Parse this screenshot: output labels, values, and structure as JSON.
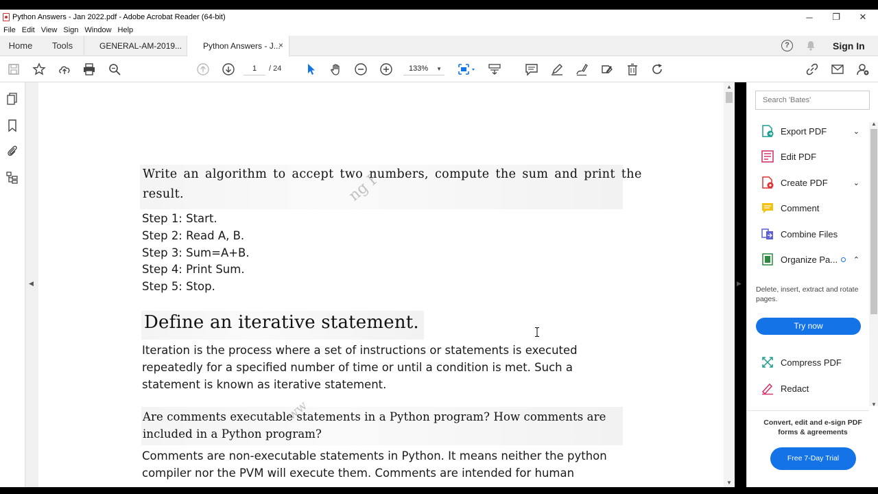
{
  "window": {
    "title": "Python Answers - Jan 2022.pdf - Adobe Acrobat Reader (64-bit)",
    "controls": {
      "minimize": "─",
      "maximize": "❐",
      "close": "✕"
    }
  },
  "menu": [
    "File",
    "Edit",
    "View",
    "Sign",
    "Window",
    "Help"
  ],
  "tabs": {
    "home": "Home",
    "tools": "Tools",
    "docs": [
      {
        "label": "GENERAL-AM-2019..."
      },
      {
        "label": "Python Answers - J...",
        "close": "×"
      }
    ],
    "help": "?",
    "signin": "Sign In"
  },
  "toolbar": {
    "page_current": "1",
    "page_total": "/ 24",
    "zoom": "133%",
    "zoom_caret": "▼"
  },
  "right_panel": {
    "search_placeholder": "Search 'Bates'",
    "items": [
      {
        "label": "Export PDF",
        "icon": "export-pdf-icon",
        "chevron": "⌄"
      },
      {
        "label": "Edit PDF",
        "icon": "edit-pdf-icon"
      },
      {
        "label": "Create PDF",
        "icon": "create-pdf-icon",
        "chevron": "⌄"
      },
      {
        "label": "Comment",
        "icon": "comment-icon"
      },
      {
        "label": "Combine Files",
        "icon": "combine-files-icon"
      },
      {
        "label": "Organize Pa...",
        "icon": "organize-pages-icon",
        "chevron": "⌃"
      },
      {
        "label": "Compress PDF",
        "icon": "compress-pdf-icon"
      },
      {
        "label": "Redact",
        "icon": "redact-icon"
      }
    ],
    "organize_desc": "Delete, insert, extract and rotate pages.",
    "try_now": "Try now",
    "promo": "Convert, edit and e-sign PDF forms & agreements",
    "trial": "Free 7-Day Trial"
  },
  "document": {
    "q1": "Write an algorithm to accept two numbers, compute the sum and print the result.",
    "q1_line1": "Write an algorithm to accept two numbers, compute the sum and print the",
    "q1_line2": "result.",
    "steps": [
      "Step 1: Start.",
      "Step 2: Read A, B.",
      "Step 3: Sum=A+B.",
      "Step 4: Print Sum.",
      "Step 5: Stop."
    ],
    "h2": "Define an iterative statement.",
    "p2_lines": [
      "Iteration is the process where a set of instructions or statements is executed",
      "repeatedly for a specified number of time or until a condition is met. Such a",
      "statement is known as iterative statement."
    ],
    "q3_line1": "Are comments executable statements in a Python program? How comments are",
    "q3_line2": "included in a Python program?",
    "p3_lines": [
      "Comments are non-executable statements in Python. It means neither the python",
      "compiler nor the PVM will execute them. Comments are intended for human"
    ]
  },
  "colors": {
    "accent": "#1473e6",
    "toolbar_bg": "#ffffff",
    "tabbar_bg": "#f0f0f0"
  }
}
